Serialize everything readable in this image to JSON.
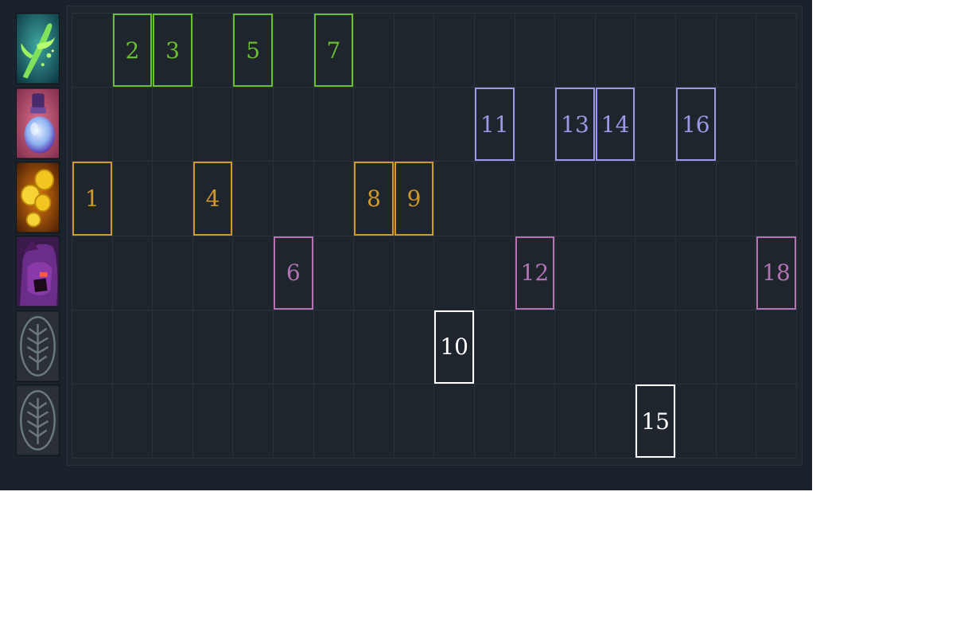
{
  "rows": [
    {
      "icon": "green-liquid-ability-icon",
      "color": "#6abf2e",
      "cards": [
        "2",
        "3",
        "5",
        "7"
      ],
      "columns": [
        2,
        3,
        5,
        7
      ]
    },
    {
      "icon": "bottle-ability-icon",
      "color": "#9a9ae6",
      "cards": [
        "11",
        "13",
        "14",
        "16"
      ],
      "columns": [
        11,
        13,
        14,
        16
      ]
    },
    {
      "icon": "gold-coins-ability-icon",
      "color": "#d1982a",
      "cards": [
        "1",
        "4",
        "8",
        "9"
      ],
      "columns": [
        1,
        4,
        8,
        9
      ]
    },
    {
      "icon": "purple-hero-portrait-icon",
      "color": "#b272b4",
      "cards": [
        "6",
        "12",
        "18"
      ],
      "columns": [
        6,
        12,
        18
      ]
    },
    {
      "icon": "talent-tree-icon",
      "color": "#ffffff",
      "cards": [
        "10"
      ],
      "columns": [
        10
      ]
    },
    {
      "icon": "talent-tree-icon",
      "color": "#ffffff",
      "cards": [
        "15"
      ],
      "columns": [
        15
      ]
    }
  ],
  "column_count": 18
}
